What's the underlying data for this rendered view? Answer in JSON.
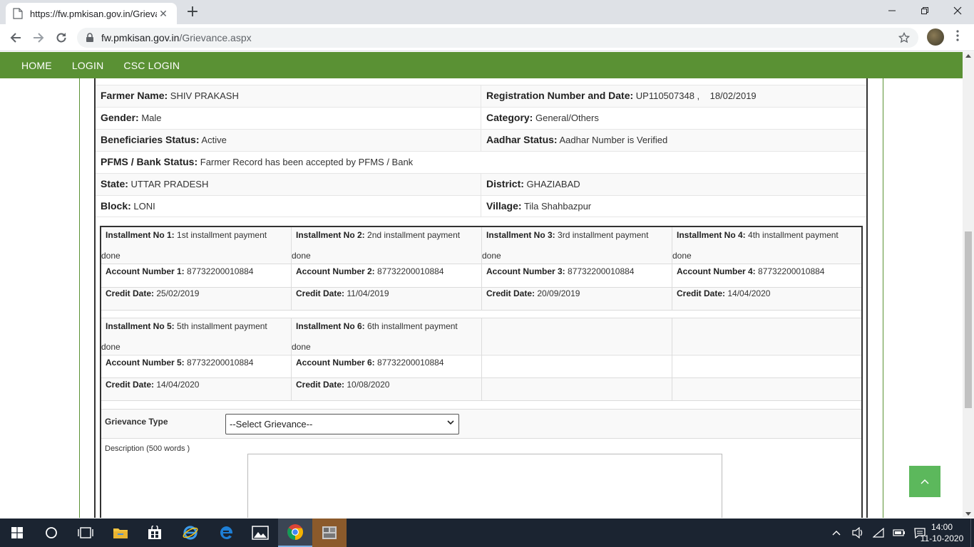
{
  "browser": {
    "tab_title": "https://fw.pmkisan.gov.in/Grievan",
    "tab_close": "✕",
    "new_tab": "+",
    "url_host": "fw.pmkisan.gov.in",
    "url_path": "/Grievance.aspx",
    "window_controls": {
      "minimize": "—",
      "restore": "❐",
      "close": "✕"
    }
  },
  "navbar": {
    "items": [
      "HOME",
      "LOGIN",
      "CSC LOGIN"
    ]
  },
  "farmer_info": {
    "rows": [
      [
        {
          "label": "Farmer Name:",
          "value": "SHIV PRAKASH"
        },
        {
          "label": "Registration Number and Date:",
          "value": "UP110507348 ,    18/02/2019"
        }
      ],
      [
        {
          "label": "Gender:",
          "value": "Male"
        },
        {
          "label": "Category:",
          "value": "General/Others"
        }
      ],
      [
        {
          "label": "Beneficiaries Status:",
          "value": "Active"
        },
        {
          "label": "Aadhar Status:",
          "value": "Aadhar Number is Verified"
        }
      ],
      [
        {
          "label": "PFMS / Bank Status:",
          "value": "Farmer Record has been accepted by PFMS / Bank"
        }
      ],
      [
        {
          "label": "State:",
          "value": "UTTAR PRADESH"
        },
        {
          "label": "District:",
          "value": "GHAZIABAD"
        }
      ],
      [
        {
          "label": "Block:",
          "value": "LONI"
        },
        {
          "label": "Village:",
          "value": "Tila Shahbazpur"
        }
      ]
    ]
  },
  "installments": [
    {
      "no_label": "Installment No 1:",
      "status": "1st installment payment",
      "status2": "done",
      "acct_label": "Account Number 1:",
      "acct": "87732200010884",
      "date_label": "Credit Date:",
      "date": "25/02/2019"
    },
    {
      "no_label": "Installment No 2:",
      "status": "2nd installment payment",
      "status2": "done",
      "acct_label": "Account Number 2:",
      "acct": "87732200010884",
      "date_label": "Credit Date:",
      "date": "11/04/2019"
    },
    {
      "no_label": "Installment No 3:",
      "status": "3rd installment payment",
      "status2": "done",
      "acct_label": "Account Number 3:",
      "acct": "87732200010884",
      "date_label": "Credit Date:",
      "date": "20/09/2019"
    },
    {
      "no_label": "Installment No 4:",
      "status": "4th installment payment",
      "status2": "done",
      "acct_label": "Account Number 4:",
      "acct": "87732200010884",
      "date_label": "Credit Date:",
      "date": "14/04/2020"
    },
    {
      "no_label": "Installment No 5:",
      "status": "5th installment payment",
      "status2": "done",
      "acct_label": "Account Number 5:",
      "acct": "87732200010884",
      "date_label": "Credit Date:",
      "date": "14/04/2020"
    },
    {
      "no_label": "Installment No 6:",
      "status": "6th installment payment",
      "status2": "done",
      "acct_label": "Account Number 6:",
      "acct": "87732200010884",
      "date_label": "Credit Date:",
      "date": "10/08/2020"
    }
  ],
  "grievance": {
    "type_label": "Grievance Type",
    "select_value": "--Select Grievance--",
    "description_label": "Description (500 words )"
  },
  "taskbar": {
    "time": "14:00",
    "date": "11-10-2020"
  },
  "colors": {
    "navbar": "#5a9134",
    "scroll_top_button": "#5cb85c",
    "taskbar": "#1b2431"
  }
}
